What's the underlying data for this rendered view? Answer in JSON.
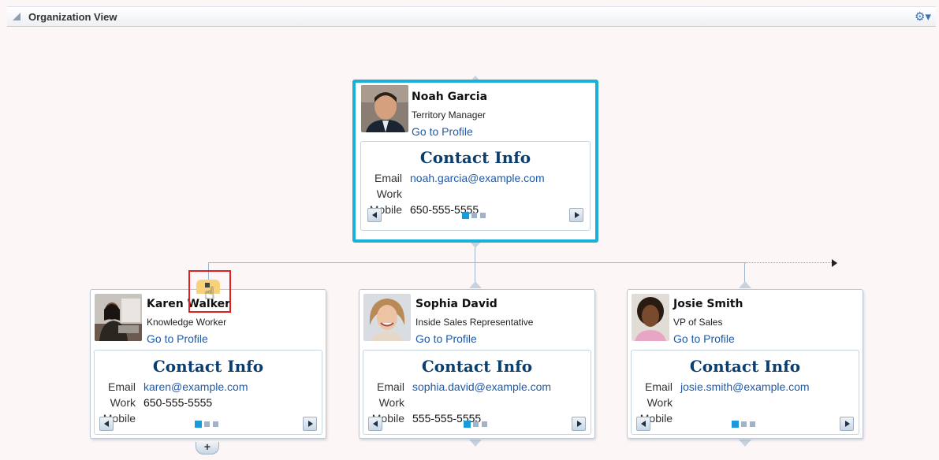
{
  "panel": {
    "title": "Organization View",
    "menu_icon": "gear-icon"
  },
  "colors": {
    "selected_border": "#1ab0d8",
    "link": "#1f5aa8",
    "heading": "#0c3e6d",
    "active_dot": "#1a9ad8"
  },
  "cards": [
    {
      "name": "Noah Garcia",
      "role": "Territory Manager",
      "profile_link": "Go to Profile",
      "contact_title": "Contact Info",
      "email_label": "Email",
      "email": "noah.garcia@example.com",
      "work_label": "Work",
      "work": "",
      "mobile_label": "Mobile",
      "mobile": "650-555-5555",
      "selected": true
    },
    {
      "name": "Karen Walker",
      "role": "Knowledge Worker",
      "profile_link": "Go to Profile",
      "contact_title": "Contact Info",
      "email_label": "Email",
      "email": "karen@example.com",
      "work_label": "Work",
      "work": "650-555-5555",
      "mobile_label": "Mobile",
      "mobile": "",
      "selected": false
    },
    {
      "name": "Sophia David",
      "role": "Inside Sales Representative",
      "profile_link": "Go to Profile",
      "contact_title": "Contact Info",
      "email_label": "Email",
      "email": "sophia.david@example.com",
      "work_label": "Work",
      "work": "",
      "mobile_label": "Mobile",
      "mobile": "555-555-5555",
      "selected": false
    },
    {
      "name": "Josie Smith",
      "role": "VP of Sales",
      "profile_link": "Go to Profile",
      "contact_title": "Contact Info",
      "email_label": "Email",
      "email": "josie.smith@example.com",
      "work_label": "Work",
      "work": "",
      "mobile_label": "Mobile",
      "mobile": "",
      "selected": false
    }
  ],
  "expand_button": {
    "label": "+"
  }
}
